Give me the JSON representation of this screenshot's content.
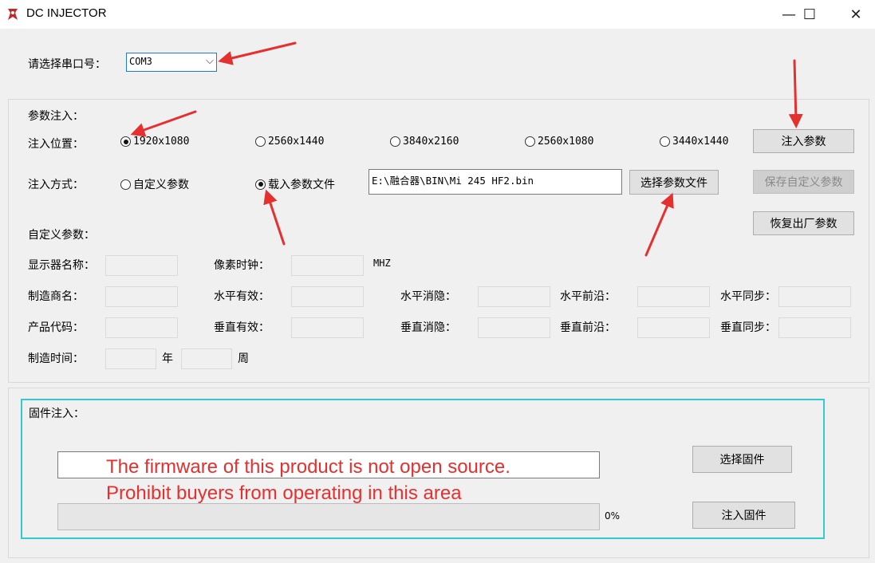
{
  "window": {
    "title": "DC INJECTOR",
    "minimize": "—",
    "maximize": "☐",
    "close": "✕"
  },
  "port": {
    "label": "请选择串口号：",
    "selected": "COM3"
  },
  "params_group": {
    "title": "参数注入：",
    "position_label": "注入位置：",
    "resolutions": [
      {
        "label": "1920x1080",
        "selected": true
      },
      {
        "label": "2560x1440",
        "selected": false
      },
      {
        "label": "3840x2160",
        "selected": false
      },
      {
        "label": "2560x1080",
        "selected": false
      },
      {
        "label": "3440x1440",
        "selected": false
      }
    ],
    "method_label": "注入方式：",
    "method_custom": "自定义参数",
    "method_file": "载入参数文件",
    "method_selected": "file",
    "file_path": "E:\\融合器\\BIN\\Mi 245 HF2.bin",
    "select_file_button": "选择参数文件",
    "inject_button": "注入参数",
    "save_custom_button": "保存自定义参数",
    "restore_button": "恢复出厂参数",
    "custom_title": "自定义参数：",
    "fields": {
      "display_name": "显示器名称：",
      "manufacturer": "制造商名：",
      "product_code": "产品代码：",
      "manufacture_time": "制造时间：",
      "year_unit": "年",
      "week_unit": "周",
      "pixel_clock": "像素时钟：",
      "pixel_clock_unit": "MHZ",
      "h_active": "水平有效：",
      "v_active": "垂直有效：",
      "h_blank": "水平消隐：",
      "v_blank": "垂直消隐：",
      "h_front": "水平前沿：",
      "v_front": "垂直前沿：",
      "h_sync": "水平同步：",
      "v_sync": "垂直同步："
    }
  },
  "firmware_group": {
    "title": "固件注入：",
    "select_button": "选择固件",
    "inject_button": "注入固件",
    "progress_percent": "0%",
    "progress_value": 0,
    "warning_line1": "The firmware of this product is not open source.",
    "warning_line2": "Prohibit buyers from operating in this area"
  },
  "colors": {
    "annotation_red": "#e53030",
    "highlight_cyan": "#34c8d0"
  }
}
